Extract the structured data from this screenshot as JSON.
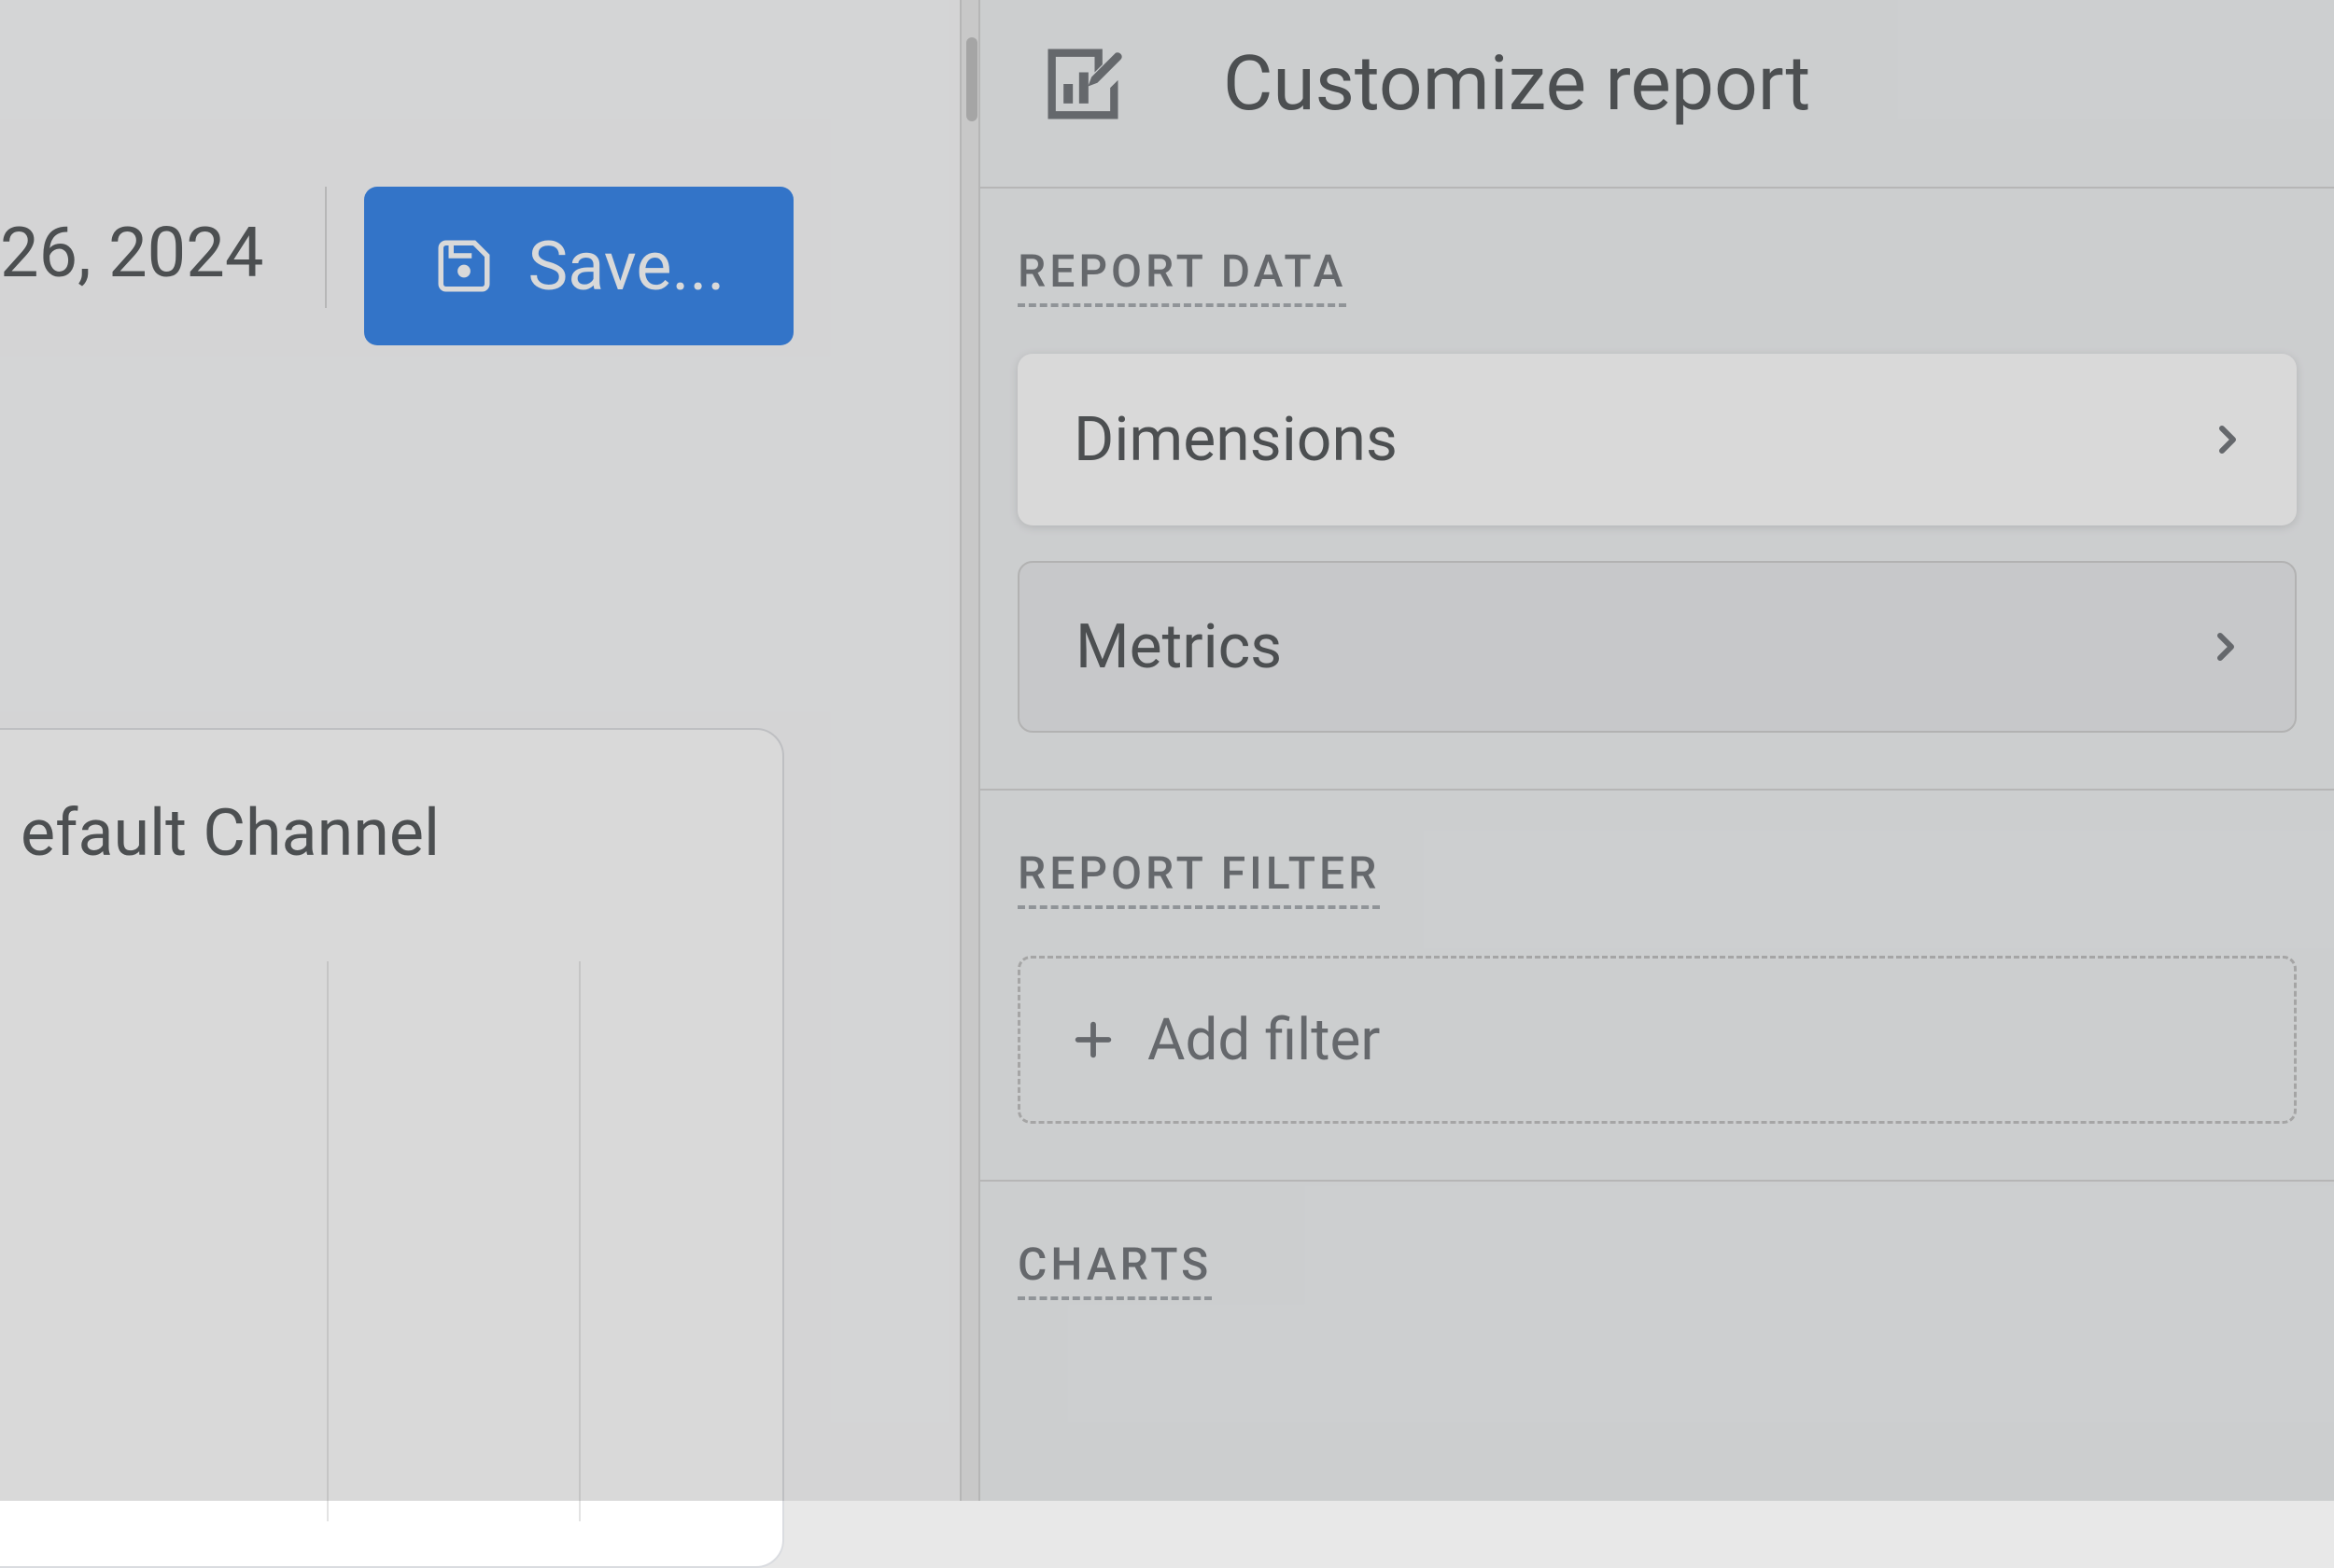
{
  "left": {
    "date_fragment": "26, 2024",
    "save_label": "Save...",
    "card_title_fragment": "efault Channel"
  },
  "panel": {
    "title": "Customize report",
    "sections": {
      "report_data": {
        "label": "REPORT DATA",
        "items": [
          {
            "label": "Dimensions",
            "active": true
          },
          {
            "label": "Metrics",
            "active": false
          }
        ]
      },
      "report_filter": {
        "label": "REPORT FILTER",
        "add_label": "Add filter"
      },
      "charts": {
        "label": "CHARTS"
      }
    }
  }
}
